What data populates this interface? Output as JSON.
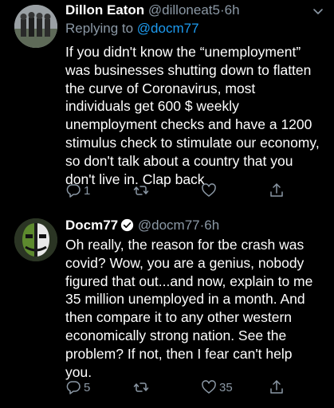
{
  "tweets": [
    {
      "name": "Dillon Eaton",
      "handle": "@dilloneat5",
      "time": "6h",
      "reply_prefix": "Replying to ",
      "reply_to": "@docm77",
      "text": "If you didn't know the “unemployment”\nwas businesses shutting down to flatten\nthe curve of Coronavirus, most\nindividuals get 600 $ weekly\nunemployment checks and have a 1200\nstimulus check to stimulate our economy,\nso don't talk about a country that you\ndon't live in. Clap back",
      "replies": "1",
      "retweets": "",
      "likes": ""
    },
    {
      "name": "Docm77",
      "handle": "@docm77",
      "time": "6h",
      "text": "Oh really, the reason for tbe crash was\ncovid? Wow, you are a genius, nobody\nfigured that out...and now, explain to me\n35 million unemployed in a month. And\nthen compare it to any other western\neconomically strong nation. See the\nproblem? If not, then I fear can't help\nyou.",
      "replies": "5",
      "retweets": "",
      "likes": "35"
    }
  ],
  "separator": "·",
  "colors": {
    "background": "#000000",
    "muted": "#8b98a5",
    "link": "#1d9bf0"
  },
  "icons": [
    "reply-icon",
    "retweet-icon",
    "like-icon",
    "share-icon",
    "chevron-down-icon",
    "verified-badge-icon"
  ]
}
